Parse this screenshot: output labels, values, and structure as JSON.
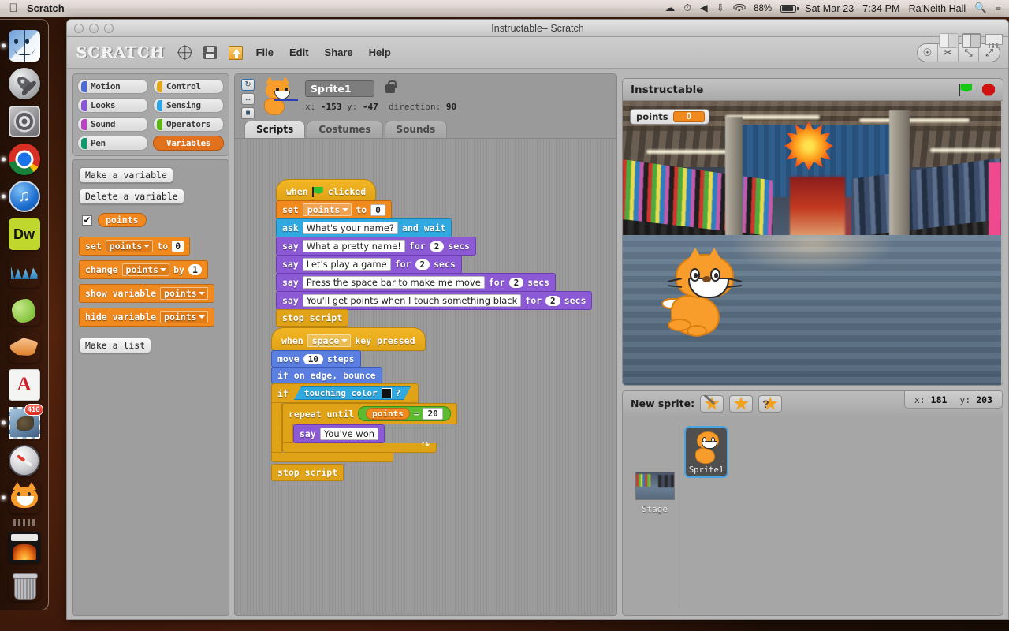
{
  "menubar": {
    "app_name": "Scratch",
    "apple_icon": "apple-icon",
    "icons": [
      "cloud-icon",
      "time-machine-icon",
      "volume-icon",
      "bluetooth-icon",
      "wifi-icon"
    ],
    "battery_percent": "88%",
    "date": "Sat Mar 23",
    "time": "7:34 PM",
    "user": "Ra'Neith Hall",
    "search_icon": "search-icon",
    "notification_icon": "notification-center-icon"
  },
  "dock": {
    "items": [
      {
        "name": "finder",
        "running": true
      },
      {
        "name": "launchpad",
        "running": false
      },
      {
        "name": "system-preferences",
        "running": false
      },
      {
        "name": "google-chrome",
        "running": true
      },
      {
        "name": "itunes",
        "running": true
      },
      {
        "name": "dreamweaver",
        "label": "Dw",
        "running": false
      },
      {
        "name": "word-app",
        "running": false
      },
      {
        "name": "green-app",
        "running": false
      },
      {
        "name": "powerpoint-app",
        "running": false
      },
      {
        "name": "adobe-acrobat",
        "running": false
      },
      {
        "name": "mail",
        "running": true,
        "badge": "416"
      },
      {
        "name": "safari",
        "running": false
      },
      {
        "name": "scratch",
        "running": true
      },
      {
        "name": "fireplace-folder",
        "running": false
      },
      {
        "name": "trash",
        "running": false
      }
    ]
  },
  "window": {
    "title": "Instructable– Scratch",
    "logo": "SCRATCH",
    "toolbar_icons": [
      "globe-icon",
      "save-icon",
      "export-icon"
    ],
    "menus": [
      "File",
      "Edit",
      "Share",
      "Help"
    ],
    "view_buttons": [
      "stamp-icon",
      "scissors-icon",
      "grow-icon",
      "shrink-icon"
    ],
    "layout_buttons": [
      "small-stage-icon",
      "normal-stage-icon",
      "presentation-icon"
    ]
  },
  "palette": {
    "categories_left": [
      {
        "label": "Motion",
        "color": "#4a6cd4"
      },
      {
        "label": "Looks",
        "color": "#8a55d7"
      },
      {
        "label": "Sound",
        "color": "#bb42c3"
      },
      {
        "label": "Pen",
        "color": "#0e9a6c"
      }
    ],
    "categories_right": [
      {
        "label": "Control",
        "color": "#e1a91a"
      },
      {
        "label": "Sensing",
        "color": "#2ca5e2"
      },
      {
        "label": "Operators",
        "color": "#5cb712"
      },
      {
        "label": "Variables",
        "color": "#ee7d16",
        "active": true
      }
    ],
    "make_variable": "Make a variable",
    "delete_variable": "Delete a variable",
    "variable_name": "points",
    "variable_checked": true,
    "make_list": "Make a list",
    "blocks": [
      {
        "id": "set",
        "words": [
          "set",
          "to"
        ],
        "dropdown": "points",
        "value": "0"
      },
      {
        "id": "change",
        "words": [
          "change",
          "by"
        ],
        "dropdown": "points",
        "value": "1"
      },
      {
        "id": "show",
        "words": [
          "show variable"
        ],
        "dropdown": "points"
      },
      {
        "id": "hide",
        "words": [
          "hide variable"
        ],
        "dropdown": "points"
      }
    ]
  },
  "sprite_header": {
    "name": "Sprite1",
    "x_label": "x:",
    "x_value": "-153",
    "y_label": "y:",
    "y_value": "-47",
    "direction_label": "direction:",
    "direction_value": "90",
    "lock_icon": "lock-icon",
    "rotation_buttons": [
      "rotate-icon",
      "flip-horizontal-icon",
      "no-rotate-icon"
    ],
    "tabs": [
      {
        "label": "Scripts",
        "active": true
      },
      {
        "label": "Costumes",
        "active": false
      },
      {
        "label": "Sounds",
        "active": false
      }
    ]
  },
  "scripts": {
    "stack1": {
      "hat": {
        "when": "when",
        "flag": "green-flag-icon",
        "clicked": "clicked"
      },
      "set": {
        "word": "set",
        "dropdown": "points",
        "to": "to",
        "value": "0"
      },
      "ask": {
        "word": "ask",
        "question": "What's your name?",
        "tail": "and wait"
      },
      "say1": {
        "word": "say",
        "text": "What a pretty name!",
        "for": "for",
        "secs_value": "2",
        "secs": "secs"
      },
      "say2": {
        "word": "say",
        "text": "Let's play a game",
        "for": "for",
        "secs_value": "2",
        "secs": "secs"
      },
      "say3": {
        "word": "say",
        "text": "Press the space bar to make me move",
        "for": "for",
        "secs_value": "2",
        "secs": "secs"
      },
      "say4": {
        "word": "say",
        "text": "You'll get points when I touch something black",
        "for": "for",
        "secs_value": "2",
        "secs": "secs"
      },
      "stop": {
        "label": "stop script"
      }
    },
    "stack2": {
      "hat": {
        "when": "when",
        "key": "space",
        "pressed": "key pressed"
      },
      "move": {
        "word": "move",
        "value": "10",
        "tail": "steps"
      },
      "bounce": {
        "label": "if on edge, bounce"
      },
      "if": {
        "word": "if",
        "condition": "touching color",
        "color": "#111111",
        "qmark": "?"
      },
      "repeat": {
        "words": "repeat until",
        "variable": "points",
        "operator": "=",
        "value": "20"
      },
      "say": {
        "word": "say",
        "text": "You've won"
      },
      "loop_arrow": "loop-arrow-icon",
      "stop": {
        "label": "stop script"
      }
    }
  },
  "stage": {
    "title": "Instructable",
    "green_flag": "green-flag-icon",
    "stop_sign": "stop-sign-icon",
    "watcher": {
      "label": "points",
      "value": "0"
    },
    "mouse_x_label": "x:",
    "mouse_x": "181",
    "mouse_y_label": "y:",
    "mouse_y": "203"
  },
  "sprite_panel": {
    "new_sprite_label": "New sprite:",
    "new_sprite_buttons": [
      "paint-new-sprite-icon",
      "import-sprite-icon",
      "surprise-sprite-icon"
    ],
    "stage_label": "Stage",
    "sprites": [
      {
        "name": "Sprite1",
        "selected": true
      }
    ]
  }
}
